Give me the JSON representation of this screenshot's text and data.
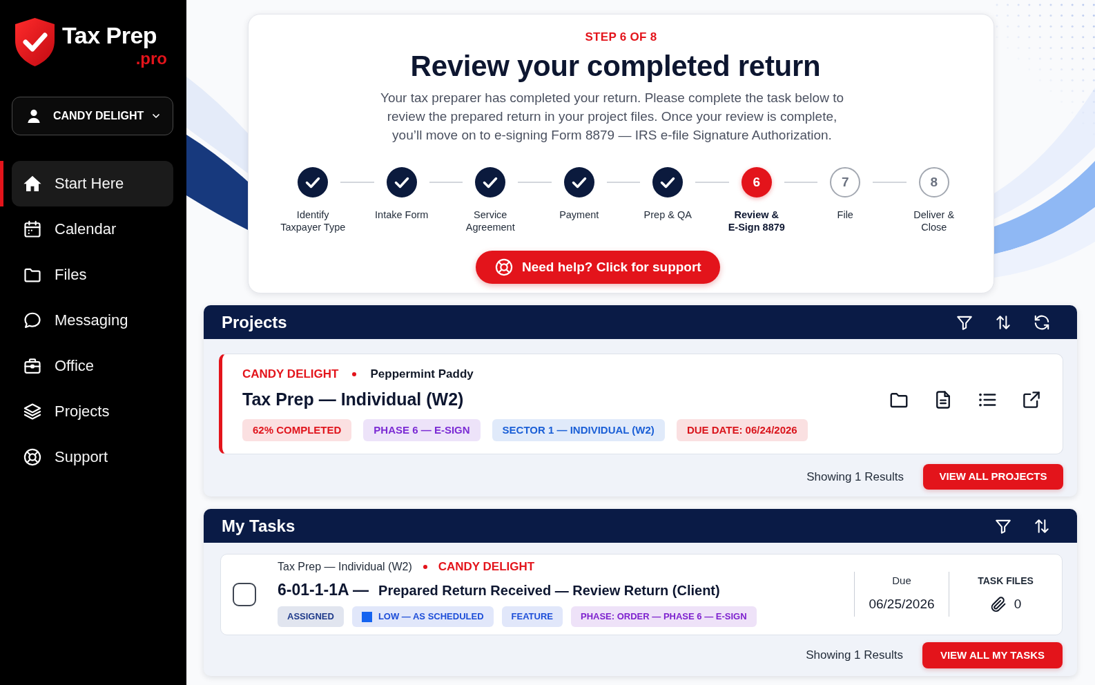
{
  "sidebar": {
    "logo": {
      "name": "Tax Prep",
      "suffix": ".pro"
    },
    "user_menu": {
      "label": "CANDY DELIGHT"
    },
    "nav_items": [
      {
        "label": "Start Here",
        "selected": true
      },
      {
        "label": "Calendar",
        "selected": false
      },
      {
        "label": "Files",
        "selected": false
      },
      {
        "label": "Messaging",
        "selected": false
      },
      {
        "label": "Office",
        "selected": false
      },
      {
        "label": "Projects",
        "selected": false
      },
      {
        "label": "Support",
        "selected": false
      }
    ]
  },
  "progress_card": {
    "step_counter": "STEP 6 OF 8",
    "title": "Review your completed return",
    "description": "Your tax preparer has completed your return. Please complete the task below to review the prepared return in your project files. Once your review is complete, you’ll move on to e-signing Form 8879 — IRS e-file Signature Authorization.",
    "steps": [
      {
        "label": "Identify\nTaxpayer Type",
        "completed": true,
        "selected": false
      },
      {
        "label": "Intake Form",
        "completed": true,
        "selected": false
      },
      {
        "label": "Service\nAgreement",
        "completed": true,
        "selected": false
      },
      {
        "label": "Payment",
        "completed": true,
        "selected": false
      },
      {
        "label": "Prep & QA",
        "completed": true,
        "selected": false
      },
      {
        "number": "6",
        "label": "Review &\nE-Sign 8879",
        "completed": false,
        "selected": true
      },
      {
        "number": "7",
        "label": "File",
        "completed": false,
        "selected": false
      },
      {
        "number": "8",
        "label": "Deliver &\nClose",
        "completed": false,
        "selected": false
      }
    ],
    "help_button": "Need help? Click for support"
  },
  "projects": {
    "title": "Projects",
    "items": [
      {
        "client": "CANDY DELIGHT",
        "preparer": "Peppermint Paddy",
        "title": "Tax Prep — Individual (W2)",
        "tags": [
          {
            "text": "62% COMPLETED",
            "color": "#e0141c"
          },
          {
            "text": "PHASE 6 — E-SIGN",
            "color": "#7b2bd4"
          },
          {
            "text": "SECTOR 1 — INDIVIDUAL (W2)",
            "color": "#1a5fd6"
          },
          {
            "text": "DUE DATE: 06/24/2026",
            "color": "#d9141b"
          }
        ]
      }
    ],
    "results": "Showing 1 Results",
    "button": "VIEW ALL PROJECTS"
  },
  "tasks": {
    "title": "My Tasks",
    "items": [
      {
        "checked": false,
        "project": "Tax Prep — Individual (W2)",
        "client": "CANDY DELIGHT",
        "code": "6-01-1-1A —",
        "title": "Prepared Return Received — Review Return (Client)",
        "tags": [
          {
            "kind": "text",
            "text": "ASSIGNED",
            "color": "#1e3a8a"
          },
          {
            "kind": "swatch",
            "text": "LOW — AS SCHEDULED",
            "color": "#1d4ed8",
            "swatch": {
              "color": "#1463f0"
            }
          },
          {
            "kind": "text",
            "text": "FEATURE",
            "color": "#1d4ed8"
          },
          {
            "kind": "text",
            "text": "PHASE: ORDER — PHASE 6 — E-SIGN",
            "color": "#7e22ce"
          }
        ],
        "due": {
          "label": "Due",
          "value": "06/25/2026"
        },
        "files": {
          "label": "TASK FILES",
          "count": "0"
        }
      }
    ],
    "results": "Showing 1 Results",
    "button": "VIEW ALL MY TASKS"
  }
}
